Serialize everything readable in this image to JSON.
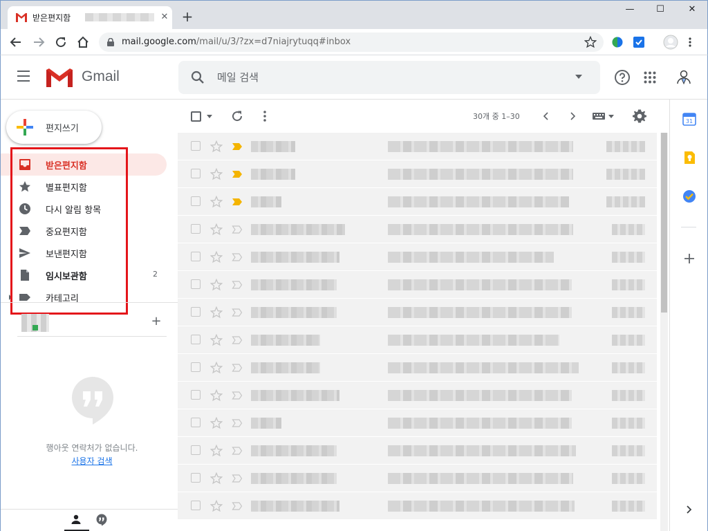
{
  "browser": {
    "tab_title": "받은편지함",
    "new_tab_label": "+",
    "close_tab_label": "✕",
    "window_minimize": "—",
    "window_maximize": "☐",
    "window_close": "✕",
    "url_host": "mail.google.com",
    "url_path": "/mail/u/3/?zx=d7niajrytuqq#inbox"
  },
  "header": {
    "app_name": "Gmail",
    "search_placeholder": "메일 검색"
  },
  "sidebar": {
    "compose_label": "편지쓰기",
    "items": [
      {
        "label": "받은편지함",
        "icon": "inbox-icon",
        "active": true
      },
      {
        "label": "별표편지함",
        "icon": "star-icon"
      },
      {
        "label": "다시 알림 항목",
        "icon": "clock-icon"
      },
      {
        "label": "중요편지함",
        "icon": "important-icon"
      },
      {
        "label": "보낸편지함",
        "icon": "send-icon"
      },
      {
        "label": "임시보관함",
        "icon": "draft-icon",
        "count": "2",
        "bold": true
      },
      {
        "label": "카테고리",
        "icon": "label-icon",
        "expandable": true
      }
    ],
    "add_contact_label": "+",
    "no_contacts_text": "행아웃 연락처가 없습니다.",
    "find_user_link": "사용자 검색"
  },
  "toolbar": {
    "pager_text": "30개 중 1–30"
  },
  "colors": {
    "accent": "#d93025",
    "active_bg": "#fce8e6",
    "important_marker": "#f4b400",
    "highlight_box": "#e4151a"
  }
}
